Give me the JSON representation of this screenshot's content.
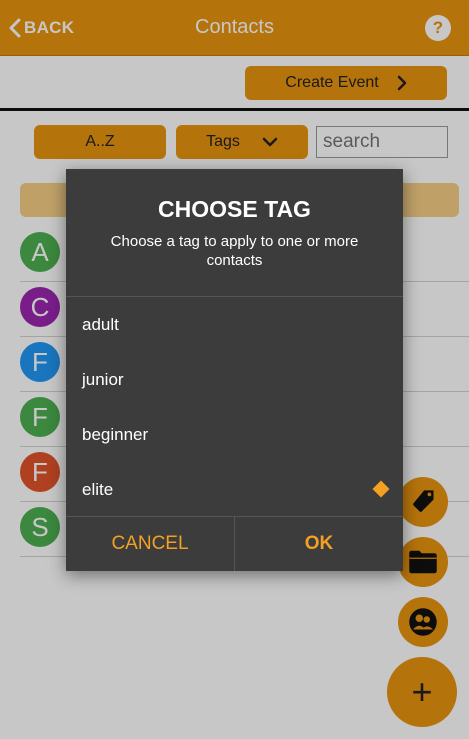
{
  "header": {
    "back_label": "BACK",
    "title": "Contacts",
    "help_label": "?"
  },
  "toolbar": {
    "create_event_label": "Create Event"
  },
  "filters": {
    "sort_label": "A..Z",
    "tags_label": "Tags",
    "search_placeholder": "search"
  },
  "contacts": [
    {
      "initial": "A",
      "color": "#4caf50"
    },
    {
      "initial": "C",
      "color": "#9c27b0"
    },
    {
      "initial": "F",
      "color": "#2196f3"
    },
    {
      "initial": "F",
      "color": "#4caf50"
    },
    {
      "initial": "F",
      "color": "#e0542a"
    },
    {
      "initial": "S",
      "color": "#4caf50"
    }
  ],
  "fabs": {
    "icons": [
      "tag-icon",
      "folder-icon",
      "group-icon",
      "plus-icon"
    ],
    "add_label": "+"
  },
  "dialog": {
    "title": "CHOOSE TAG",
    "subtitle": "Choose a tag to apply to one or more contacts",
    "options": [
      {
        "label": "adult",
        "selected": false
      },
      {
        "label": "junior",
        "selected": false
      },
      {
        "label": "beginner",
        "selected": false
      },
      {
        "label": "elite",
        "selected": true
      }
    ],
    "cancel_label": "CANCEL",
    "ok_label": "OK"
  },
  "colors": {
    "accent": "#e8940f",
    "dialog_bg": "#3c3c3c",
    "dialog_action": "#f4a023"
  }
}
